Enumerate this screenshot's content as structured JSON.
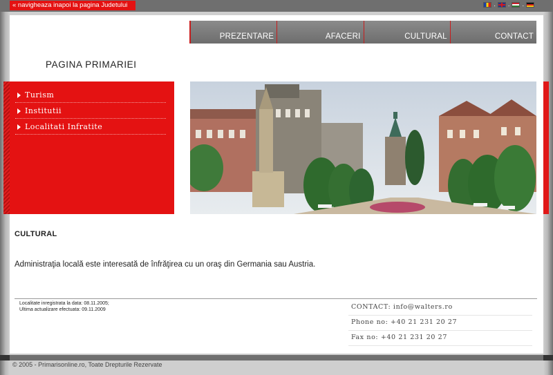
{
  "top": {
    "back_link": "« navigheaza inapoi la pagina Judetului",
    "languages": [
      "ro-flag-icon",
      "uk-flag-icon",
      "hu-flag-icon",
      "de-flag-icon"
    ],
    "separator": "."
  },
  "nav": {
    "items": [
      {
        "label": "PREZENTARE"
      },
      {
        "label": "AFACERI"
      },
      {
        "label": "CULTURAL"
      },
      {
        "label": "CONTACT"
      }
    ]
  },
  "header": {
    "title": "PAGINA PRIMARIEI"
  },
  "sidebar": {
    "items": [
      {
        "label": "Turism"
      },
      {
        "label": "Institutii"
      },
      {
        "label": "Localitati Infratite"
      }
    ]
  },
  "main": {
    "section_title": "CULTURAL",
    "text": "Administraţia locală este interesată de înfrăţirea cu un oraş din Germania sau Austria."
  },
  "footer": {
    "registered": "Localitate inregistrata la data: 08.11.2005;",
    "updated": "Ultima actualizare efectuata: 09.11.2009",
    "contact": "CONTACT: info@walters.ro",
    "phone": "Phone no: +40 21 231 20 27",
    "fax": "Fax no: +40 21 231 20 27",
    "copyright": "© 2005 - Primarisonline.ro, Toate Drepturile Rezervate"
  },
  "colors": {
    "accent_red": "#e41212",
    "nav_gray": "#7a7a7a",
    "frame_gray": "#6f6f6f"
  }
}
